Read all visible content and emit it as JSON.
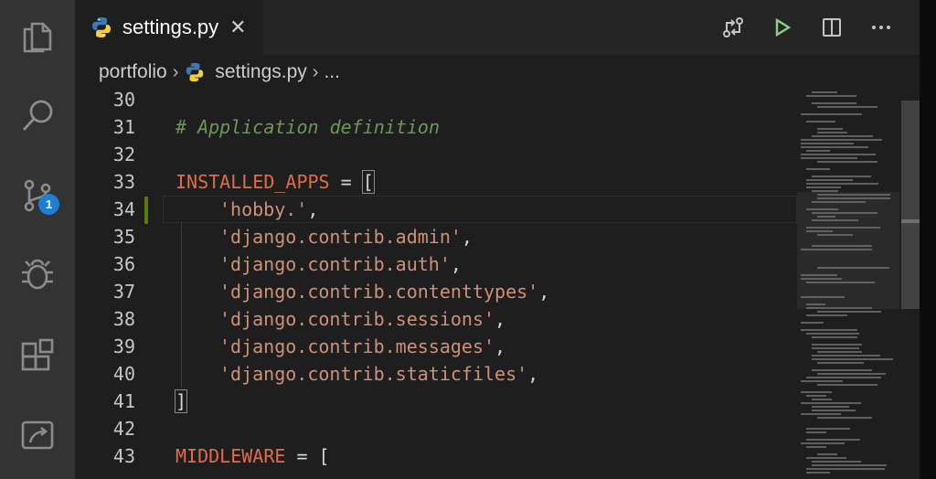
{
  "tab": {
    "label": "settings.py",
    "close": "✕"
  },
  "breadcrumb": {
    "folder": "portfolio",
    "file": "settings.py",
    "more": "..."
  },
  "activity": {
    "scm_badge": "1"
  },
  "lines": [
    {
      "num": "30",
      "text": ""
    },
    {
      "num": "31",
      "text": "# Application definition"
    },
    {
      "num": "32",
      "text": ""
    },
    {
      "num": "33",
      "var": "INSTALLED_APPS",
      "rest": " = ",
      "bracket": "["
    },
    {
      "num": "34",
      "str": "'hobby.'",
      "tail": ","
    },
    {
      "num": "35",
      "str": "'django.contrib.admin'",
      "tail": ","
    },
    {
      "num": "36",
      "str": "'django.contrib.auth'",
      "tail": ","
    },
    {
      "num": "37",
      "str": "'django.contrib.contenttypes'",
      "tail": ","
    },
    {
      "num": "38",
      "str": "'django.contrib.sessions'",
      "tail": ","
    },
    {
      "num": "39",
      "str": "'django.contrib.messages'",
      "tail": ","
    },
    {
      "num": "40",
      "str": "'django.contrib.staticfiles'",
      "tail": ","
    },
    {
      "num": "41",
      "bracket": "]"
    },
    {
      "num": "42",
      "text": ""
    },
    {
      "num": "43",
      "var": "MIDDLEWARE",
      "rest": " = ["
    }
  ]
}
